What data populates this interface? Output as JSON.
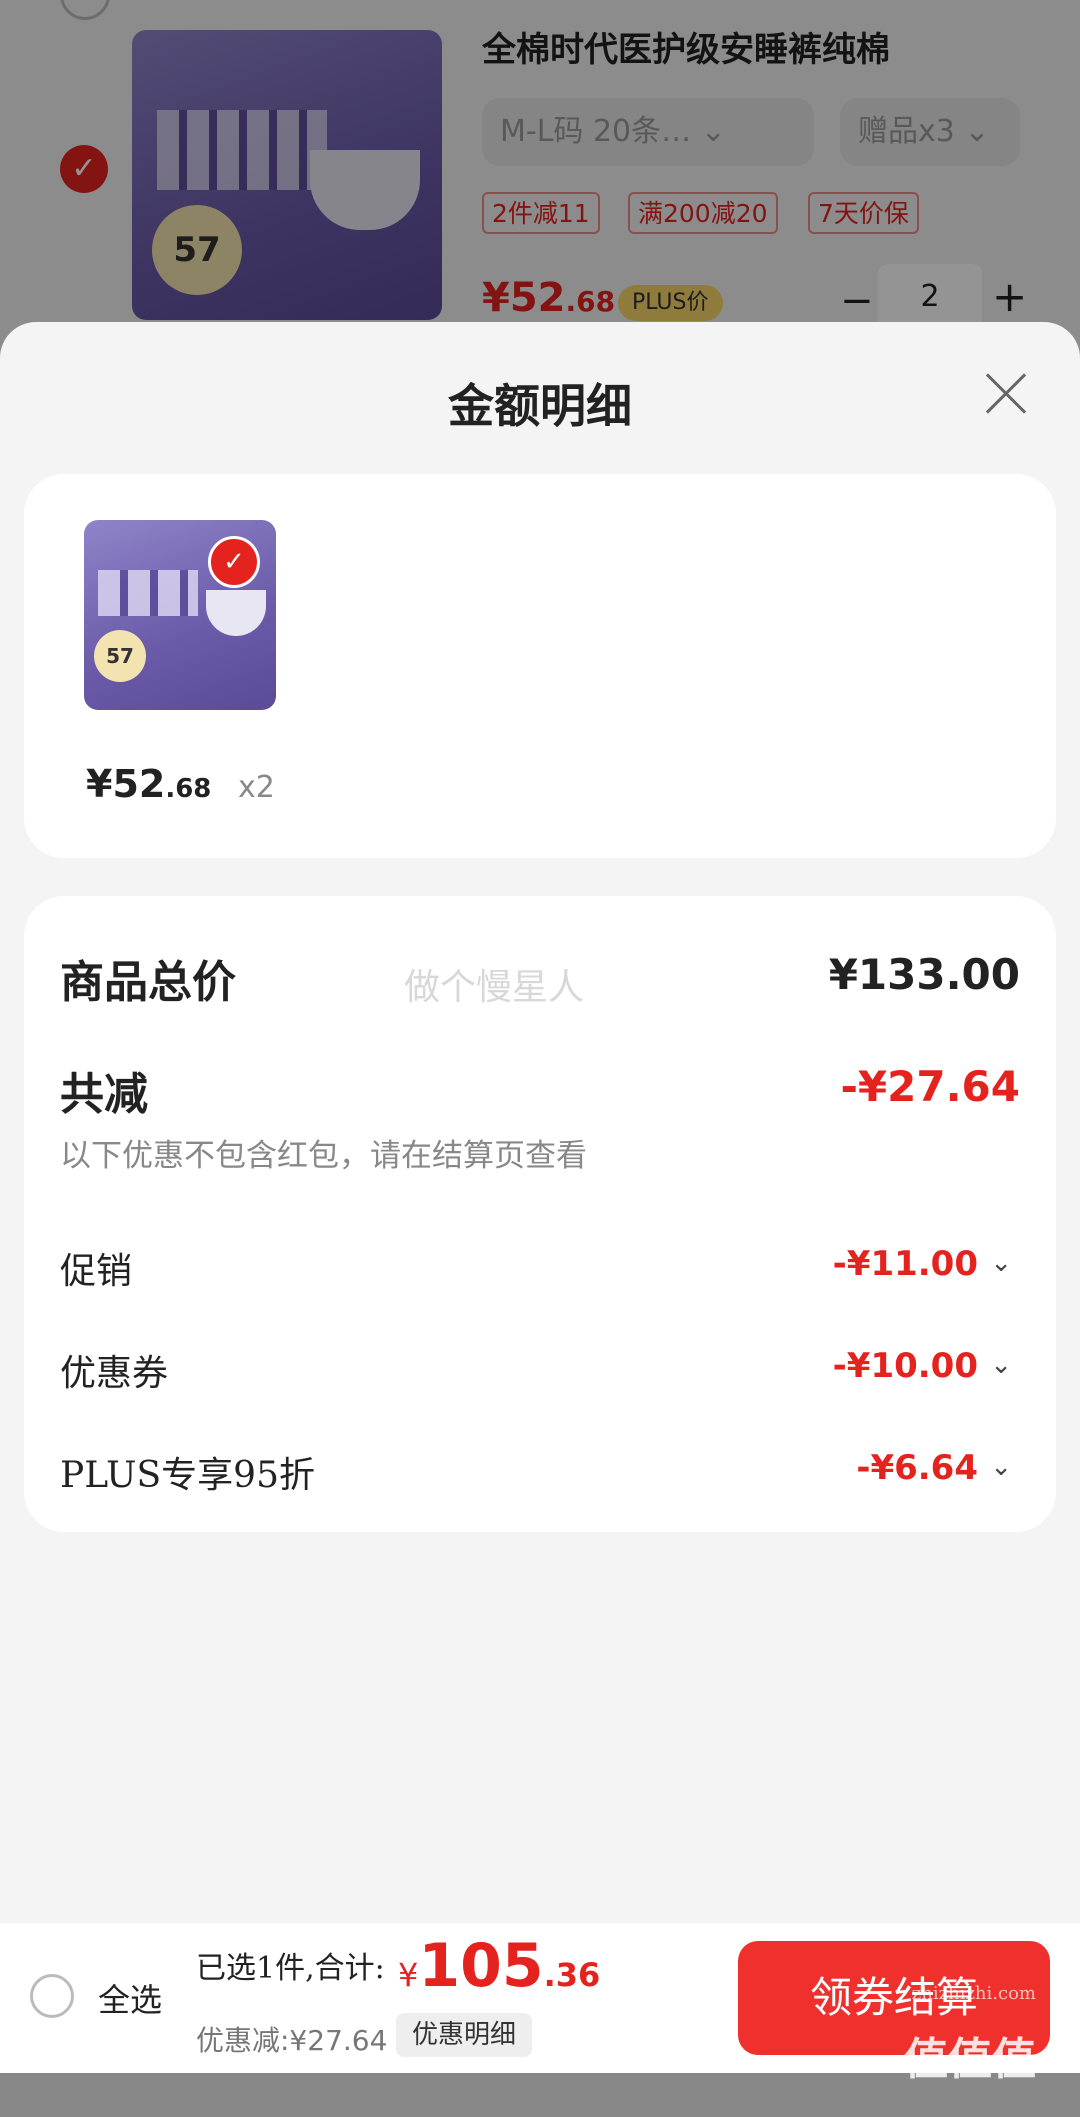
{
  "background_item": {
    "title": "全棉时代医护级安睡裤纯棉",
    "spec": "M-L码 20条…",
    "gift": "赠品x3",
    "tags": [
      "2件减11",
      "满200减20",
      "7天价保"
    ],
    "price_int": "¥52",
    "price_dec": ".68",
    "plus_badge": "PLUS价",
    "quantity": "2",
    "minus": "−",
    "plus": "+",
    "thumb_number": "57"
  },
  "sheet": {
    "title": "金额明细"
  },
  "item_card": {
    "price_int": "¥52",
    "price_dec": ".68",
    "qty": "x2",
    "thumb_number": "57"
  },
  "breakdown": {
    "total_label": "商品总价",
    "total_value": "¥133.00",
    "watermark": "做个慢星人",
    "reduce_label": "共减",
    "reduce_value": "-¥27.64",
    "note": "以下优惠不包含红包，请在结算页查看",
    "rows": [
      {
        "label": "促销",
        "value": "-¥11.00"
      },
      {
        "label": "优惠券",
        "value": "-¥10.00"
      },
      {
        "label": "PLUS专享95折",
        "value": "-¥6.64"
      }
    ]
  },
  "bottom_bar": {
    "select_all": "全选",
    "summary_prefix": "已选1件,合计:",
    "total_cur": "¥",
    "total_int": "105",
    "total_dec": ".36",
    "discount": "优惠减:¥27.64",
    "detail_button": "优惠明细",
    "checkout_button": "领券结算",
    "site_mark": "值值值",
    "site_url": "zhizhizhi.com"
  },
  "colors": {
    "accent_red": "#e4231f",
    "checkout_red": "#f0302d"
  }
}
